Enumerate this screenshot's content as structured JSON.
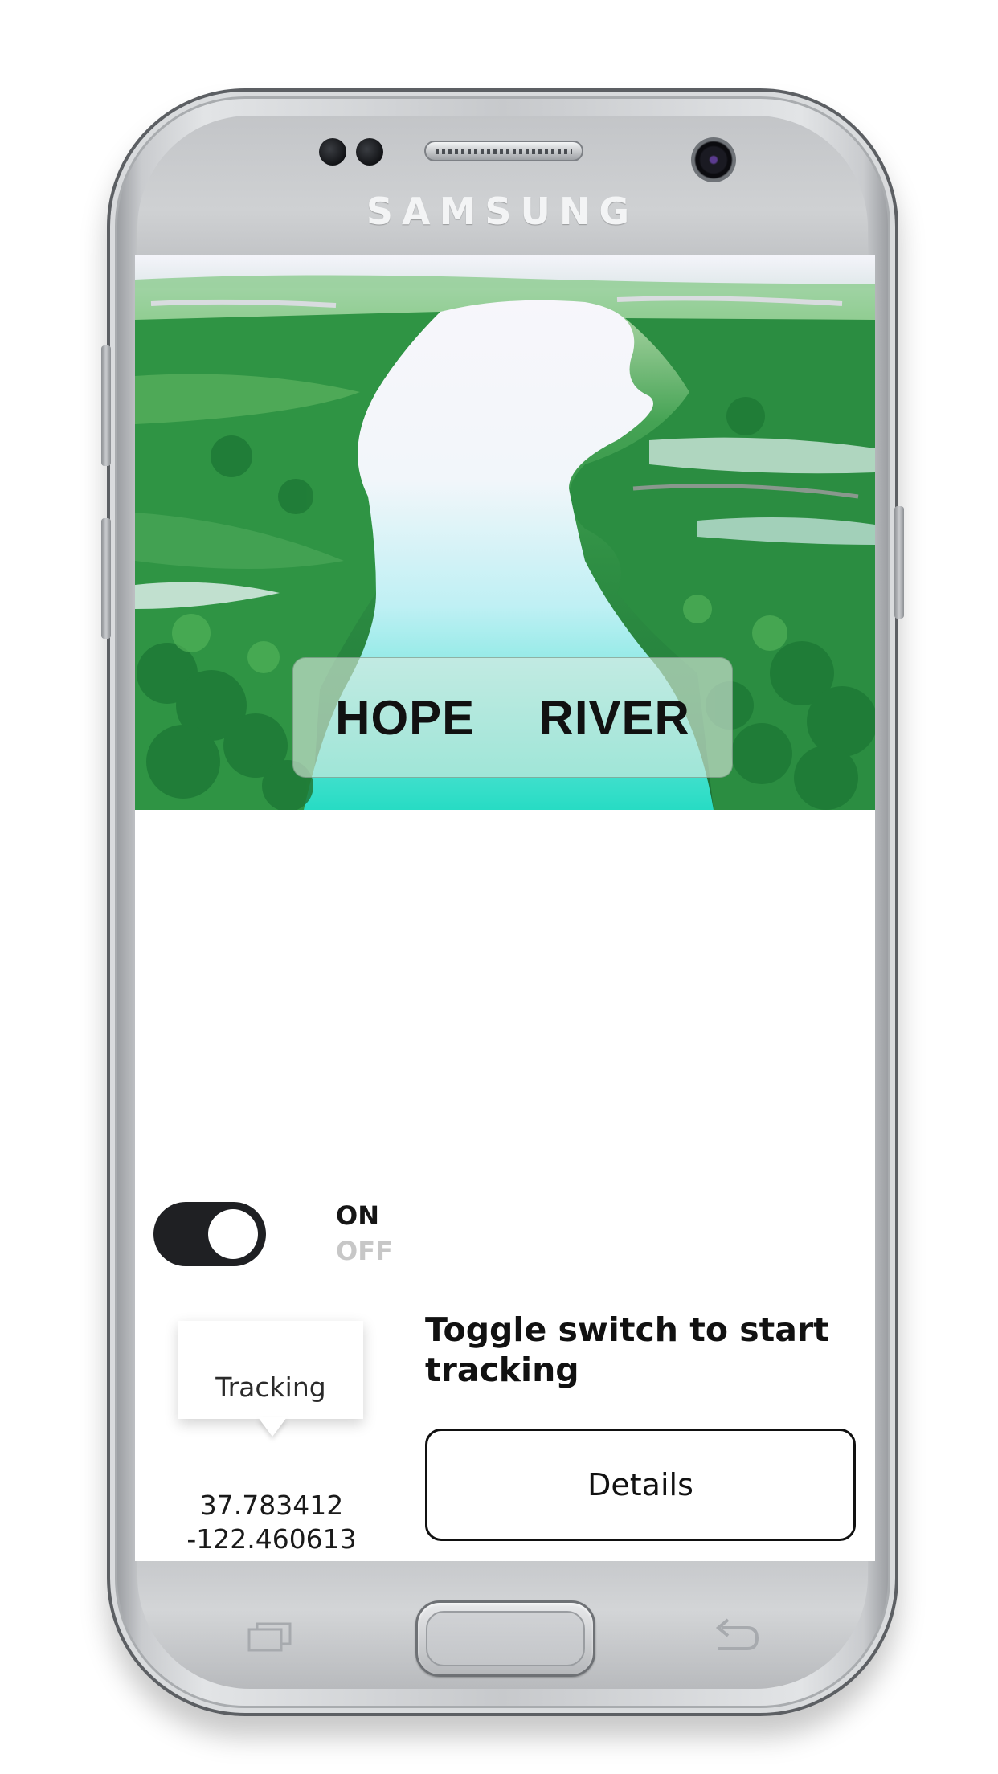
{
  "device": {
    "brand": "SAMSUNG"
  },
  "hero": {
    "title": "HOPE  RIVER",
    "image_description_icon": "river-landscape-image"
  },
  "toggle": {
    "state": "on",
    "on_label": "ON",
    "off_label": "OFF"
  },
  "tooltip": {
    "label": "Tracking"
  },
  "coordinates": {
    "latitude": "37.783412",
    "longitude": "-122.460613"
  },
  "instruction": {
    "text": "Toggle switch to start tracking"
  },
  "details_button": {
    "label": "Details"
  },
  "colors": {
    "toggle_track": "#1f2023",
    "toggle_knob": "#ffffff",
    "off_label": "#c7c7c7",
    "text": "#111111"
  }
}
